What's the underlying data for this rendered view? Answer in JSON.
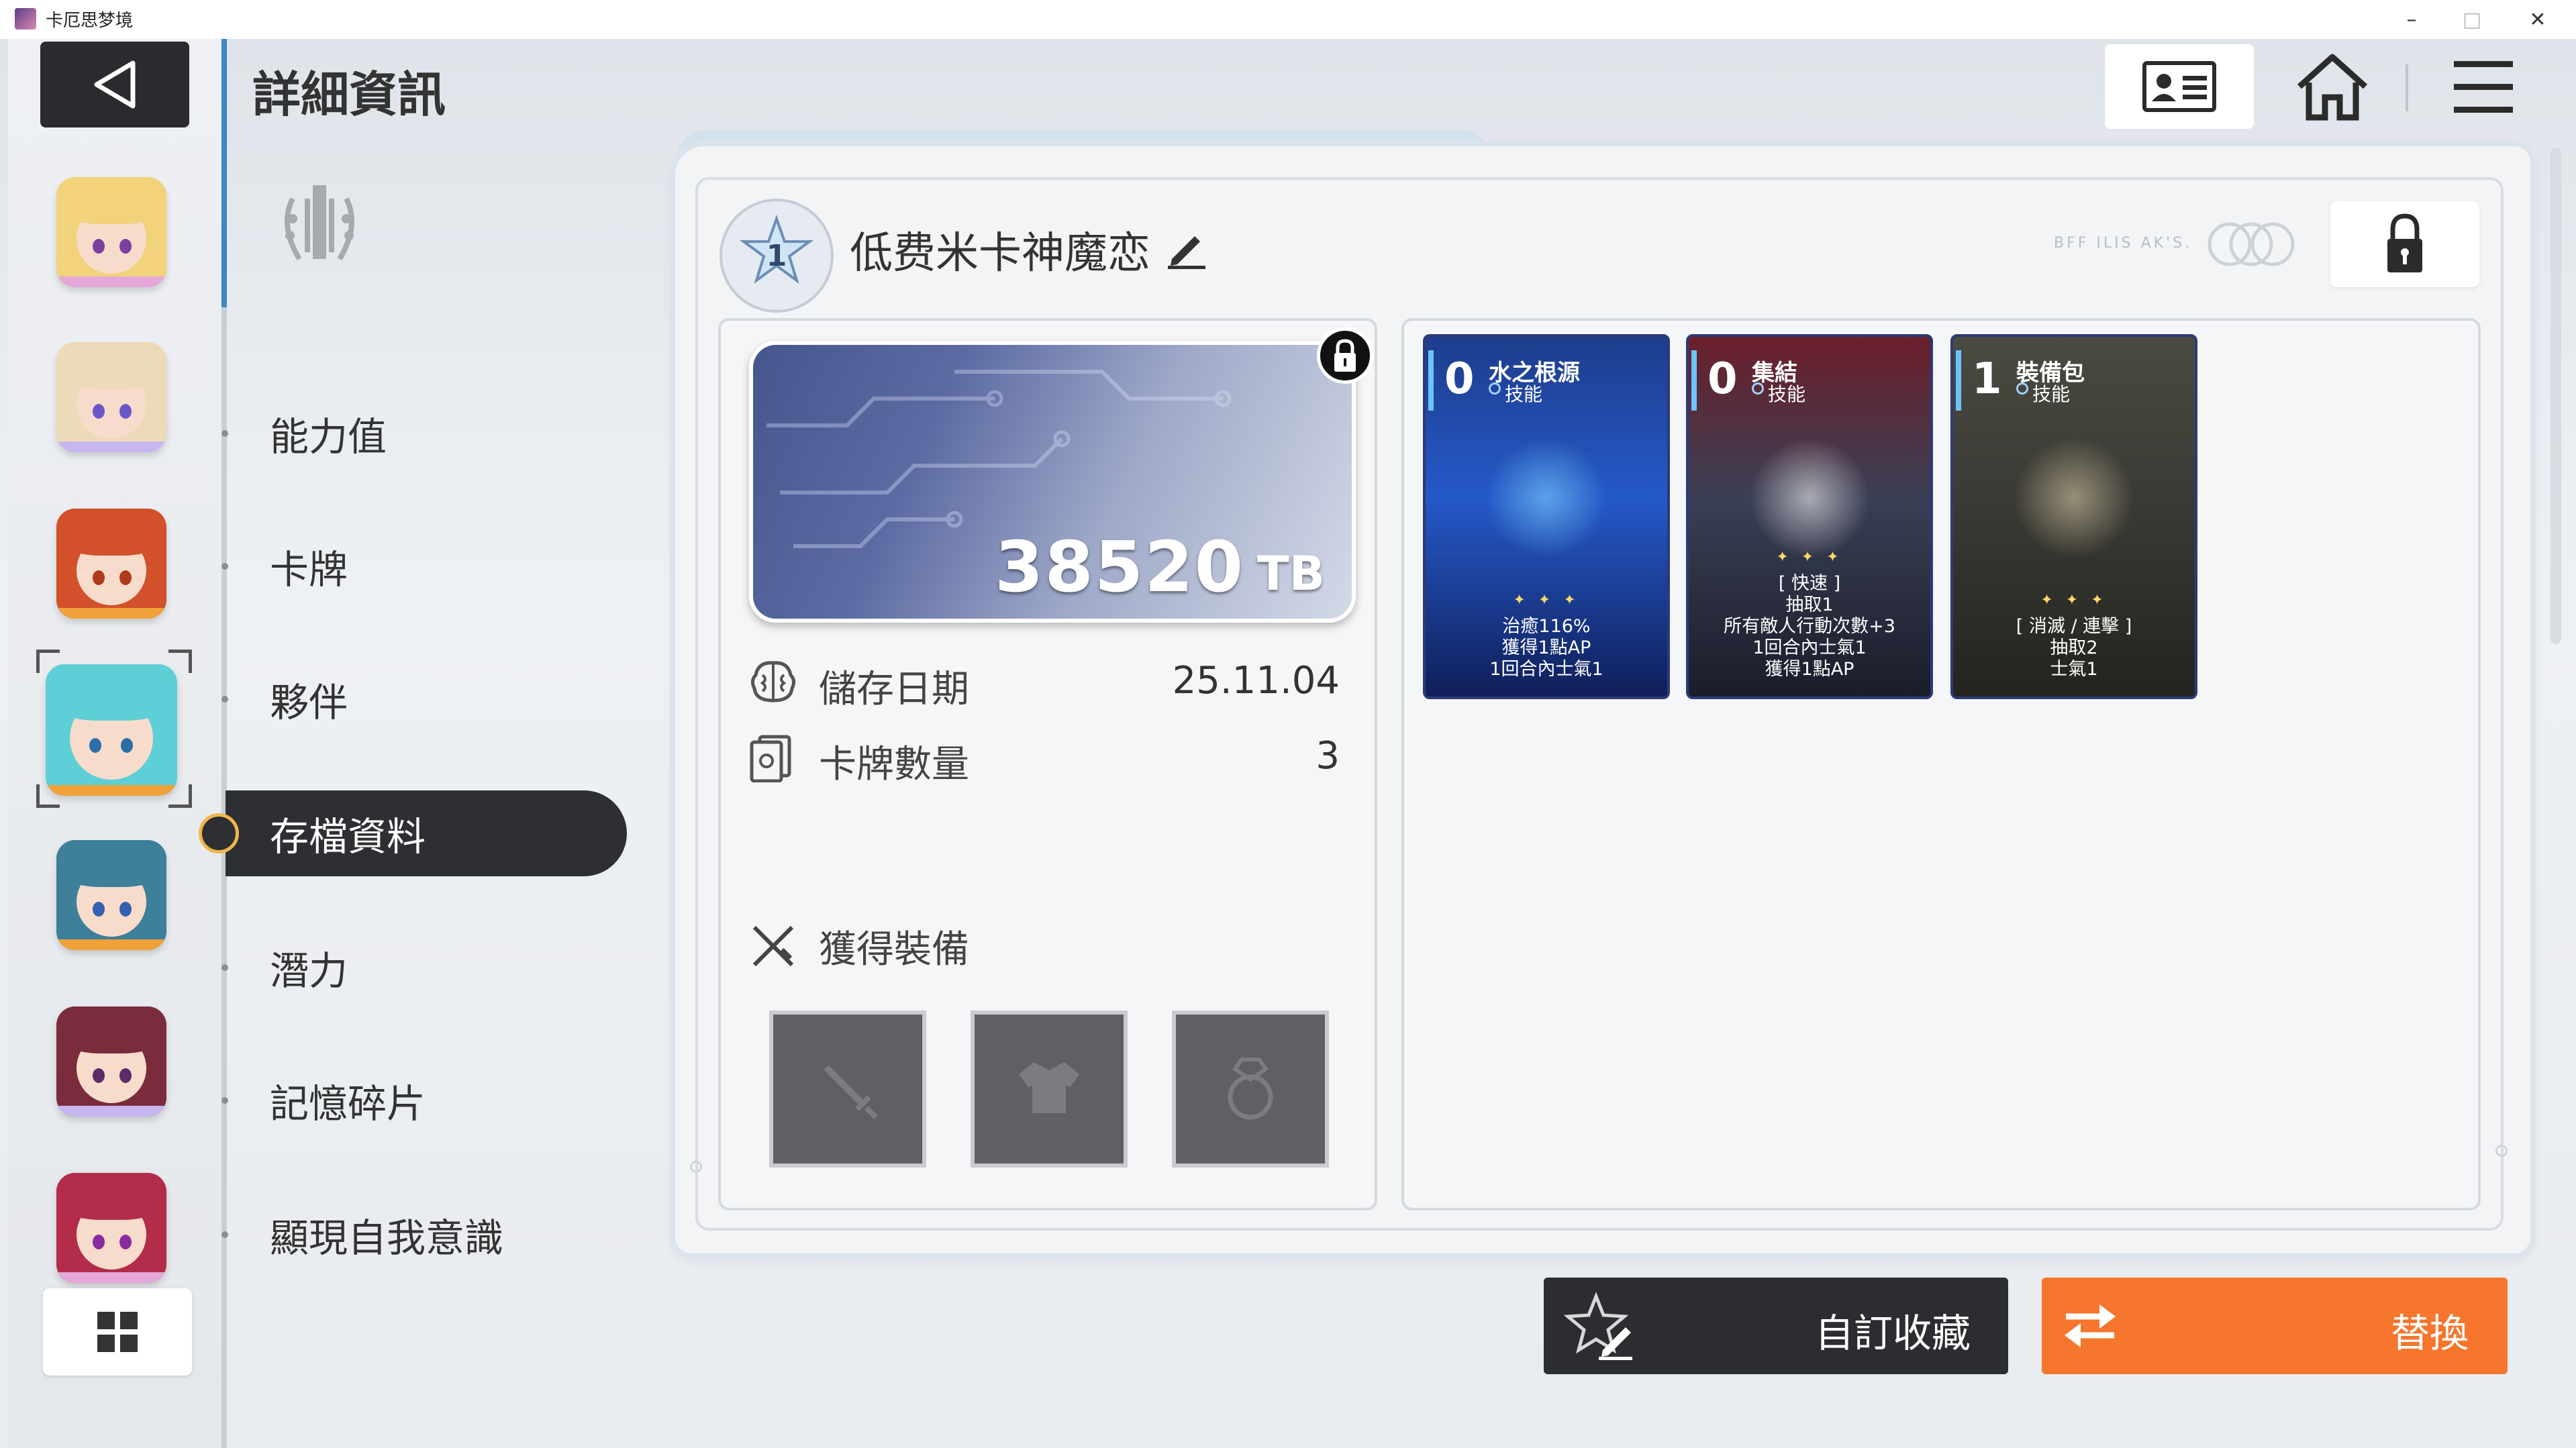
{
  "window": {
    "title": "卡厄思梦境",
    "minimize_label": "–",
    "maximize_label": "□",
    "close_label": "✕"
  },
  "header": {
    "title": "詳細資訊",
    "icons": [
      "back-arrow-icon",
      "profile-card-icon",
      "home-icon",
      "hamburger-menu-icon"
    ]
  },
  "characters": [
    {
      "name_icon": "avatar-blonde",
      "hair": "#f2d27a",
      "bar": "#e5a6d8",
      "eye": "#7a3fa0"
    },
    {
      "name_icon": "avatar-light-brown",
      "hair": "#eddab8",
      "bar": "#c7b6ef",
      "eye": "#6b56c9"
    },
    {
      "name_icon": "avatar-red-cap",
      "hair": "#d2502a",
      "bar": "#f0a13a",
      "eye": "#b03a1a"
    },
    {
      "name_icon": "avatar-teal-glasses",
      "hair": "#5ecfd6",
      "bar": "#f0a13a",
      "eye": "#2b6ea8",
      "selected": true
    },
    {
      "name_icon": "avatar-teal-headphones",
      "hair": "#3e7f99",
      "bar": "#f0a13a",
      "eye": "#3561b0"
    },
    {
      "name_icon": "avatar-maroon",
      "hair": "#7a2c3d",
      "bar": "#c7b6ef",
      "eye": "#5b2c6a"
    },
    {
      "name_icon": "avatar-crimson",
      "hair": "#b32c4a",
      "bar": "#e5a6d8",
      "eye": "#8a2aa0"
    }
  ],
  "nav": {
    "items": [
      {
        "label": "能力值"
      },
      {
        "label": "卡牌"
      },
      {
        "label": "夥伴"
      },
      {
        "label": "存檔資料",
        "active": true
      },
      {
        "label": "潛力"
      },
      {
        "label": "記憶碎片"
      },
      {
        "label": "顯現自我意識"
      }
    ]
  },
  "deck": {
    "rank": "1",
    "name": "低费米卡神魔恋",
    "faint_text": "BFF ILIS AK'S."
  },
  "save": {
    "value": "38520",
    "unit": "TB",
    "date_label": "儲存日期",
    "date_value": "25.11.04",
    "card_count_label": "卡牌數量",
    "card_count_value": "3",
    "equip_label": "獲得裝備",
    "equip_slots": [
      "sword-slot-icon",
      "armor-slot-icon",
      "ring-slot-icon"
    ]
  },
  "cards": [
    {
      "cost": "0",
      "name": "水之根源",
      "type": "技能",
      "lines": [
        "治癒116%",
        "獲得1點AP",
        "1回合內士氣1"
      ],
      "colors": {
        "top": "#1e3d8c",
        "mid": "#2559c9",
        "bottom": "#0f1f5a",
        "glow": "#7fd3ff"
      }
    },
    {
      "cost": "0",
      "name": "集結",
      "type": "技能",
      "lines": [
        "[ 快速 ]",
        "抽取1",
        "所有敵人行動次數+3",
        "1回合內士氣1",
        "獲得1點AP"
      ],
      "colors": {
        "top": "#6b1f2a",
        "mid": "#3a3f55",
        "bottom": "#1a1d2a",
        "glow": "#f2f2f2"
      }
    },
    {
      "cost": "1",
      "name": "裝備包",
      "type": "技能",
      "lines": [
        "[ 消滅 / 連擊 ]",
        "抽取2",
        "士氣1"
      ],
      "colors": {
        "top": "#4a4a42",
        "mid": "#3b3b35",
        "bottom": "#24241f",
        "glow": "#d6c7a3"
      }
    }
  ],
  "buttons": {
    "collect": "自訂收藏",
    "swap": "替換"
  },
  "accent_colors": {
    "orange": "#f5762c",
    "dark": "#2c2d31",
    "blue": "#3a86c8"
  }
}
